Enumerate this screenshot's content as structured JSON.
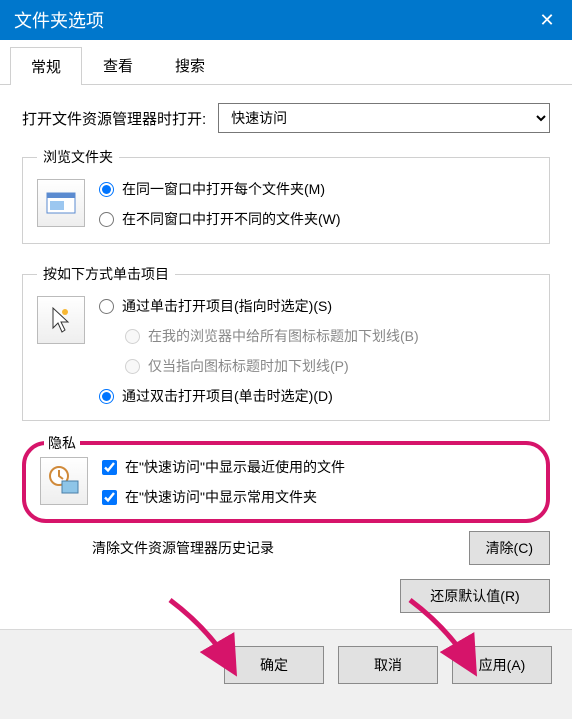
{
  "title": "文件夹选项",
  "tabs": {
    "general": "常规",
    "view": "查看",
    "search": "搜索"
  },
  "open_explorer_label": "打开文件资源管理器时打开:",
  "open_explorer_value": "快速访问",
  "browse": {
    "legend": "浏览文件夹",
    "same_window": "在同一窗口中打开每个文件夹(M)",
    "new_window": "在不同窗口中打开不同的文件夹(W)"
  },
  "click": {
    "legend": "按如下方式单击项目",
    "single": "通过单击打开项目(指向时选定)(S)",
    "underline_all": "在我的浏览器中给所有图标标题加下划线(B)",
    "underline_point": "仅当指向图标标题时加下划线(P)",
    "double": "通过双击打开项目(单击时选定)(D)"
  },
  "privacy": {
    "legend": "隐私",
    "recent_files": "在\"快速访问\"中显示最近使用的文件",
    "frequent_folders": "在\"快速访问\"中显示常用文件夹",
    "clear_label": "清除文件资源管理器历史记录",
    "clear_button": "清除(C)"
  },
  "restore_defaults": "还原默认值(R)",
  "footer": {
    "ok": "确定",
    "cancel": "取消",
    "apply": "应用(A)"
  }
}
